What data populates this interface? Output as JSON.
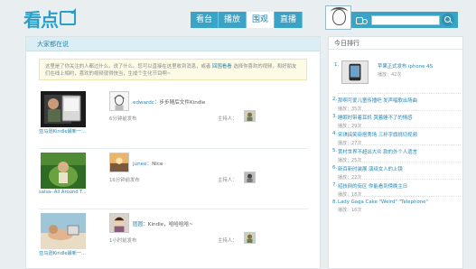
{
  "header": {
    "logo": "看点",
    "nav": [
      {
        "label": "看台"
      },
      {
        "label": "播放"
      },
      {
        "label": "围观"
      },
      {
        "label": "直播"
      }
    ]
  },
  "main": {
    "title": "大家都在说",
    "notice_part1": "这里是了你关注的人都过什么，说了什么。您可以直接在这里收到消息，或者",
    "notice_link": "回围看看",
    "notice_part2": "选择你喜欢的视频，和好朋友们在线上相约，喜欢的视频就得快当，生成个生化节目啊~",
    "items": [
      {
        "title": "亚马逊Kindle最新一...",
        "user": "edwardc",
        "text": "：步步随后文件Kindle",
        "time": "6分钟前发布",
        "owner_label": "主持人："
      },
      {
        "title": "salsa--All Around T...",
        "user": "junee",
        "text": "：Nice",
        "time": "16分钟前发布",
        "owner_label": "主持人："
      },
      {
        "title": "亚马逊Kindle最新一...",
        "user": "圆圆",
        "text": "：Kindle，哈哈哈哈~",
        "time": "1小时前发布",
        "owner_label": "主持人："
      }
    ]
  },
  "side": {
    "title": "今日排行",
    "first": {
      "num": "1.",
      "title": "苹果正式发布 iphone 4S",
      "plays": "播放：42次"
    },
    "ranks": [
      {
        "num": "2.",
        "title": "那啊可爱儿童传播吧 发声唱歌出场曲",
        "plays": "播放：35次"
      },
      {
        "num": "3.",
        "title": "睡眠时带着耳机 哭着睡不了的情感",
        "plays": "播放：29次"
      },
      {
        "num": "4.",
        "title": "宋琪搞笑街搭秀场 三杯字旗挑切视频",
        "plays": "播放：27次"
      },
      {
        "num": "5.",
        "title": "黄村世界不超出大众 款的外个人遗言",
        "plays": "播放：25次"
      },
      {
        "num": "6.",
        "title": "新百新时装展 演绎女人的上镜",
        "plays": "播放：22次"
      },
      {
        "num": "7.",
        "title": "绍技网的街区 你能看到傍晚主日",
        "plays": "播放：18次"
      },
      {
        "num": "8.",
        "title": "Lady Gaga Cake \"Weird\" \"Telephone\"",
        "plays": "播放：16次"
      }
    ]
  },
  "colors": {
    "accent": "#3ba3c5",
    "link": "#2a87b0"
  }
}
